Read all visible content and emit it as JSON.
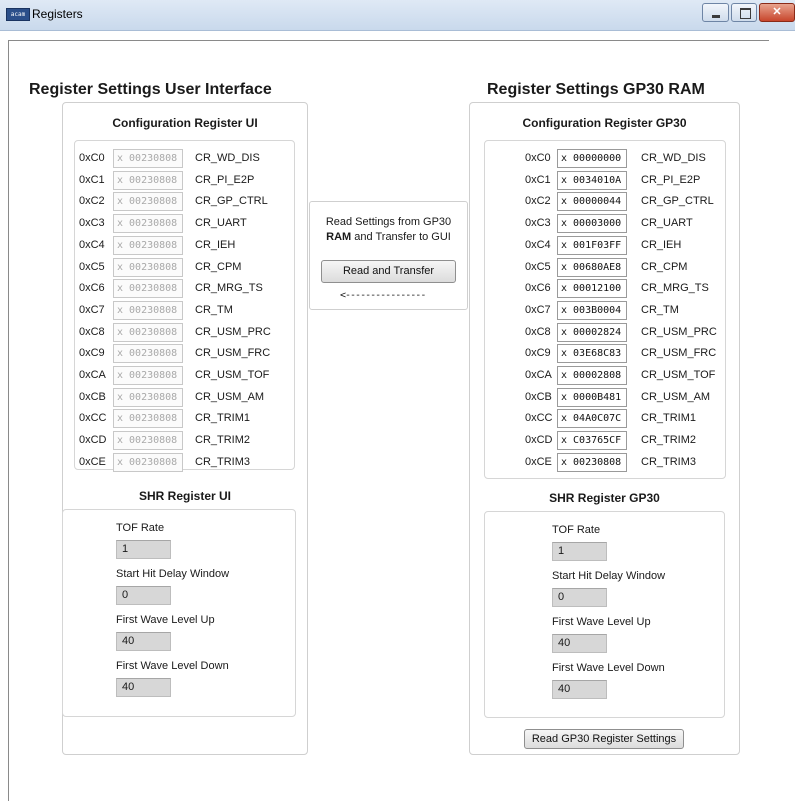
{
  "window": {
    "title": "Registers",
    "app_icon_text": "acam"
  },
  "left": {
    "title": "Register Settings User Interface",
    "config_title": "Configuration Register UI",
    "registers": [
      {
        "addr": "0xC0",
        "value": "x 00230808",
        "name": "CR_WD_DIS"
      },
      {
        "addr": "0xC1",
        "value": "x 00230808",
        "name": "CR_PI_E2P"
      },
      {
        "addr": "0xC2",
        "value": "x 00230808",
        "name": "CR_GP_CTRL"
      },
      {
        "addr": "0xC3",
        "value": "x 00230808",
        "name": "CR_UART"
      },
      {
        "addr": "0xC4",
        "value": "x 00230808",
        "name": "CR_IEH"
      },
      {
        "addr": "0xC5",
        "value": "x 00230808",
        "name": "CR_CPM"
      },
      {
        "addr": "0xC6",
        "value": "x 00230808",
        "name": "CR_MRG_TS"
      },
      {
        "addr": "0xC7",
        "value": "x 00230808",
        "name": "CR_TM"
      },
      {
        "addr": "0xC8",
        "value": "x 00230808",
        "name": "CR_USM_PRC"
      },
      {
        "addr": "0xC9",
        "value": "x 00230808",
        "name": "CR_USM_FRC"
      },
      {
        "addr": "0xCA",
        "value": "x 00230808",
        "name": "CR_USM_TOF"
      },
      {
        "addr": "0xCB",
        "value": "x 00230808",
        "name": "CR_USM_AM"
      },
      {
        "addr": "0xCC",
        "value": "x 00230808",
        "name": "CR_TRIM1"
      },
      {
        "addr": "0xCD",
        "value": "x 00230808",
        "name": "CR_TRIM2"
      },
      {
        "addr": "0xCE",
        "value": "x 00230808",
        "name": "CR_TRIM3"
      }
    ],
    "shr_title": "SHR Register UI",
    "shr": [
      {
        "label": "TOF Rate",
        "value": "1"
      },
      {
        "label": "Start Hit Delay Window",
        "value": "0"
      },
      {
        "label": "First Wave Level Up",
        "value": "40"
      },
      {
        "label": "First Wave Level Down",
        "value": "40"
      }
    ]
  },
  "middle": {
    "line1": "Read Settings from GP30",
    "line2_bold": "RAM",
    "line2_rest": " and Transfer to GUI",
    "button": "Read and Transfer",
    "arrow": "<----------------"
  },
  "right": {
    "title": "Register Settings GP30 RAM",
    "config_title": "Configuration Register GP30",
    "registers": [
      {
        "addr": "0xC0",
        "value": "x 00000000",
        "name": "CR_WD_DIS"
      },
      {
        "addr": "0xC1",
        "value": "x 0034010A",
        "name": "CR_PI_E2P"
      },
      {
        "addr": "0xC2",
        "value": "x 00000044",
        "name": "CR_GP_CTRL"
      },
      {
        "addr": "0xC3",
        "value": "x 00003000",
        "name": "CR_UART"
      },
      {
        "addr": "0xC4",
        "value": "x 001F03FF",
        "name": "CR_IEH"
      },
      {
        "addr": "0xC5",
        "value": "x 00680AE8",
        "name": "CR_CPM"
      },
      {
        "addr": "0xC6",
        "value": "x 00012100",
        "name": "CR_MRG_TS"
      },
      {
        "addr": "0xC7",
        "value": "x 003B0004",
        "name": "CR_TM"
      },
      {
        "addr": "0xC8",
        "value": "x 00002824",
        "name": "CR_USM_PRC"
      },
      {
        "addr": "0xC9",
        "value": "x 03E68C83",
        "name": "CR_USM_FRC"
      },
      {
        "addr": "0xCA",
        "value": "x 00002808",
        "name": "CR_USM_TOF"
      },
      {
        "addr": "0xCB",
        "value": "x 0000B481",
        "name": "CR_USM_AM"
      },
      {
        "addr": "0xCC",
        "value": "x 04A0C07C",
        "name": "CR_TRIM1"
      },
      {
        "addr": "0xCD",
        "value": "x C03765CF",
        "name": "CR_TRIM2"
      },
      {
        "addr": "0xCE",
        "value": "x 00230808",
        "name": "CR_TRIM3"
      }
    ],
    "shr_title": "SHR Register GP30",
    "shr": [
      {
        "label": "TOF Rate",
        "value": "1"
      },
      {
        "label": "Start Hit Delay Window",
        "value": "0"
      },
      {
        "label": "First Wave Level Up",
        "value": "40"
      },
      {
        "label": "First Wave Level Down",
        "value": "40"
      }
    ],
    "read_button": "Read GP30 Register Settings"
  }
}
